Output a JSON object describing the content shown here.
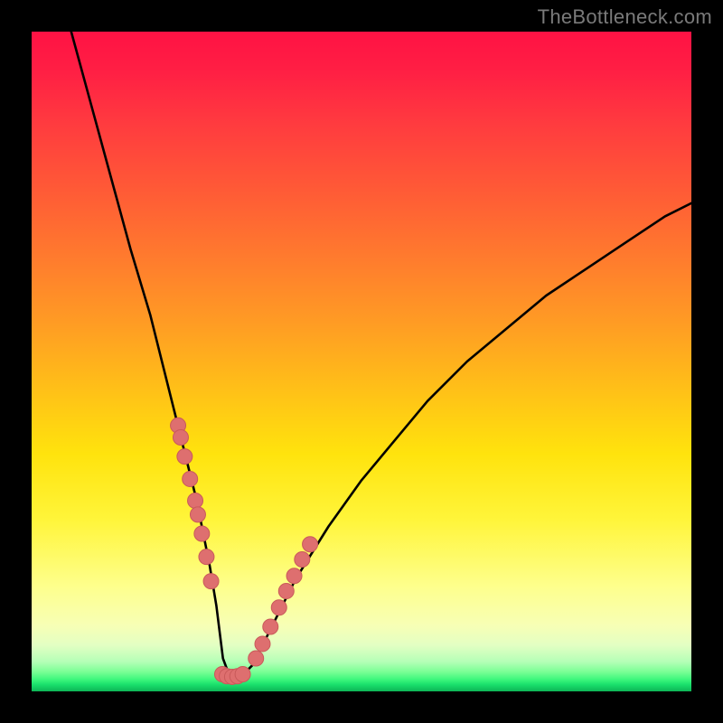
{
  "watermark": "TheBottleneck.com",
  "chart_data": {
    "type": "line",
    "title": "",
    "xlabel": "",
    "ylabel": "",
    "xlim": [
      0,
      100
    ],
    "ylim": [
      0,
      100
    ],
    "series": [
      {
        "name": "curve",
        "x": [
          6,
          9,
          12,
          15,
          18,
          20,
          22,
          23.5,
          25,
          26,
          27,
          28,
          28.5,
          29,
          30,
          30.8,
          31.8,
          33.5,
          36,
          40,
          45,
          50,
          55,
          60,
          66,
          72,
          78,
          84,
          90,
          96,
          100
        ],
        "y": [
          100,
          89,
          78,
          67,
          57,
          49,
          41,
          35,
          29,
          24,
          19,
          13,
          9,
          5,
          2.3,
          2.2,
          2.3,
          4,
          9,
          17,
          25,
          32,
          38,
          44,
          50,
          55,
          60,
          64,
          68,
          72,
          74
        ]
      }
    ],
    "annotations": {
      "dots_left": [
        {
          "x": 22.2,
          "y": 40.3
        },
        {
          "x": 22.6,
          "y": 38.5
        },
        {
          "x": 23.2,
          "y": 35.6
        },
        {
          "x": 24.0,
          "y": 32.2
        },
        {
          "x": 24.8,
          "y": 28.9
        },
        {
          "x": 25.2,
          "y": 26.8
        },
        {
          "x": 25.8,
          "y": 23.9
        },
        {
          "x": 26.5,
          "y": 20.4
        },
        {
          "x": 27.2,
          "y": 16.7
        }
      ],
      "dots_right": [
        {
          "x": 34.0,
          "y": 5.0
        },
        {
          "x": 35.0,
          "y": 7.2
        },
        {
          "x": 36.2,
          "y": 9.8
        },
        {
          "x": 37.5,
          "y": 12.7
        },
        {
          "x": 38.6,
          "y": 15.2
        },
        {
          "x": 39.8,
          "y": 17.5
        },
        {
          "x": 41.0,
          "y": 20.0
        },
        {
          "x": 42.2,
          "y": 22.3
        }
      ],
      "dots_bottom": [
        {
          "x": 28.9,
          "y": 2.6
        },
        {
          "x": 29.6,
          "y": 2.3
        },
        {
          "x": 30.4,
          "y": 2.2
        },
        {
          "x": 31.2,
          "y": 2.3
        },
        {
          "x": 32.0,
          "y": 2.6
        }
      ]
    },
    "colors": {
      "curve": "#000000",
      "dots_fill": "#de6f6f",
      "dots_stroke": "#c95a5a"
    }
  }
}
